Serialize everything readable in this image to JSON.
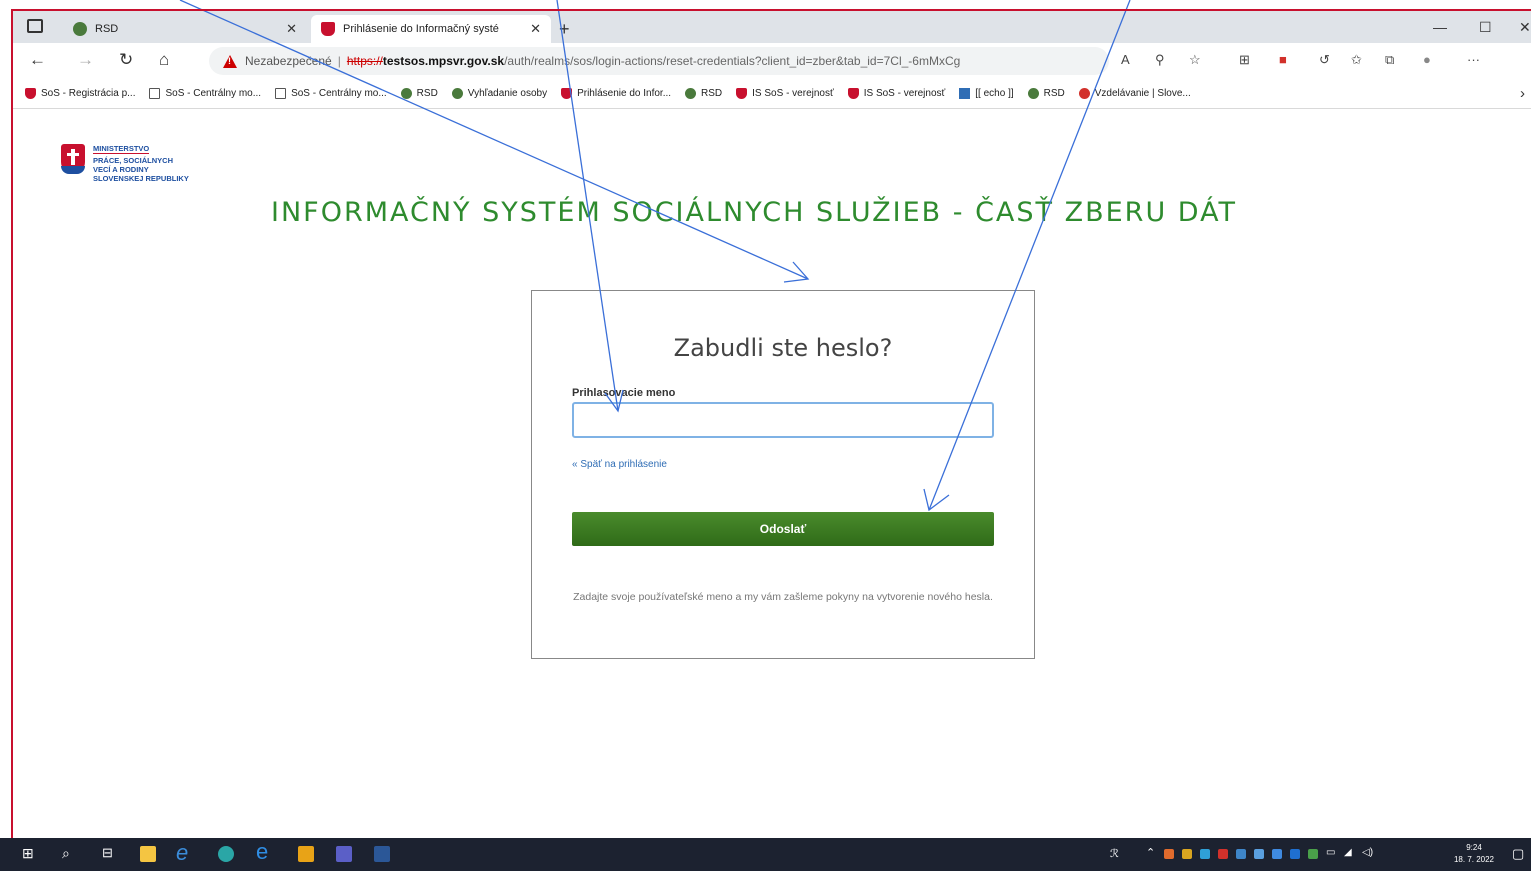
{
  "browser": {
    "tabs": [
      {
        "label": "RSD",
        "active": false
      },
      {
        "label": "Prihlásenie do Informačný systé",
        "active": true
      }
    ],
    "address": {
      "security_warning": "Nezabezpečené",
      "scheme": "https://",
      "host": "testsos.mpsvr.gov.sk",
      "path": "/auth/realms/sos/login-actions/reset-credentials?client_id=zber&tab_id=7Cl_-6mMxCg"
    },
    "favorites": [
      {
        "label": "SoS - Registrácia p...",
        "icon": "shield-icon"
      },
      {
        "label": "SoS - Centrálny mo...",
        "icon": "page-icon"
      },
      {
        "label": "SoS - Centrálny mo...",
        "icon": "page-icon"
      },
      {
        "label": "RSD",
        "icon": "people-icon"
      },
      {
        "label": "Vyhľadanie osoby",
        "icon": "people-icon"
      },
      {
        "label": "Prihlásenie do Infor...",
        "icon": "shield-icon"
      },
      {
        "label": "RSD",
        "icon": "people-icon"
      },
      {
        "label": "IS SoS - verejnosť",
        "icon": "shield-icon"
      },
      {
        "label": "IS SoS - verejnosť",
        "icon": "shield-icon"
      },
      {
        "label": "[[ echo ]]",
        "icon": "book-icon"
      },
      {
        "label": "RSD",
        "icon": "people-icon"
      },
      {
        "label": "Vzdelávanie | Slove...",
        "icon": "circle-icon"
      }
    ]
  },
  "logo": {
    "line1": "MINISTERSTVO",
    "line2": "PRÁCE, SOCIÁLNYCH",
    "line3": "VECÍ A RODINY",
    "line4": "SLOVENSKEJ REPUBLIKY"
  },
  "page": {
    "system_title": "INFORMAČNÝ SYSTÉM SOCIÁLNYCH SLUŽIEB - ČASŤ ZBERU DÁT",
    "form": {
      "title": "Zabudli ste heslo?",
      "username_label": "Prihlasovacie meno",
      "username_value": "",
      "back_link": "« Späť na prihlásenie",
      "submit_label": "Odoslať",
      "hint": "Zadajte svoje používateľské meno a my vám zašleme pokyny na vytvorenie nového hesla."
    }
  },
  "taskbar": {
    "time": "9:24",
    "date": "18. 7. 2022"
  },
  "colors": {
    "accent_green": "#2e8b2e",
    "button_green": "#3a7a22",
    "annotation_blue": "#3a6fd8",
    "frame_red": "#c8102e"
  }
}
